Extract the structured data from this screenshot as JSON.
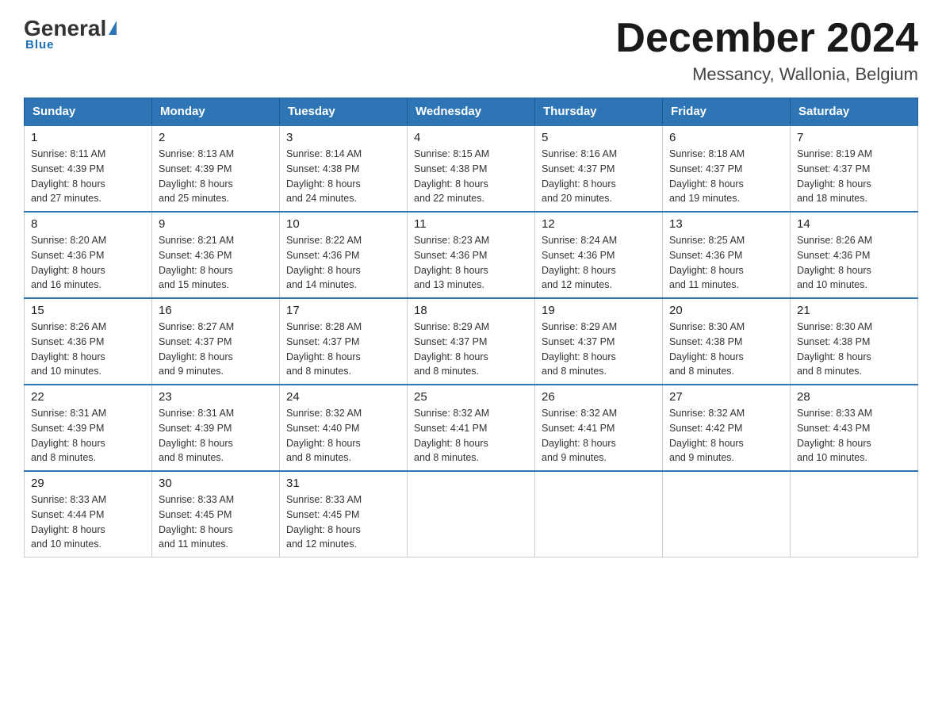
{
  "logo": {
    "general": "General",
    "blue": "Blue",
    "tagline": "Blue"
  },
  "title": {
    "month_year": "December 2024",
    "location": "Messancy, Wallonia, Belgium"
  },
  "header_days": [
    "Sunday",
    "Monday",
    "Tuesday",
    "Wednesday",
    "Thursday",
    "Friday",
    "Saturday"
  ],
  "weeks": [
    [
      {
        "day": "1",
        "sunrise": "8:11 AM",
        "sunset": "4:39 PM",
        "daylight": "8 hours and 27 minutes."
      },
      {
        "day": "2",
        "sunrise": "8:13 AM",
        "sunset": "4:39 PM",
        "daylight": "8 hours and 25 minutes."
      },
      {
        "day": "3",
        "sunrise": "8:14 AM",
        "sunset": "4:38 PM",
        "daylight": "8 hours and 24 minutes."
      },
      {
        "day": "4",
        "sunrise": "8:15 AM",
        "sunset": "4:38 PM",
        "daylight": "8 hours and 22 minutes."
      },
      {
        "day": "5",
        "sunrise": "8:16 AM",
        "sunset": "4:37 PM",
        "daylight": "8 hours and 20 minutes."
      },
      {
        "day": "6",
        "sunrise": "8:18 AM",
        "sunset": "4:37 PM",
        "daylight": "8 hours and 19 minutes."
      },
      {
        "day": "7",
        "sunrise": "8:19 AM",
        "sunset": "4:37 PM",
        "daylight": "8 hours and 18 minutes."
      }
    ],
    [
      {
        "day": "8",
        "sunrise": "8:20 AM",
        "sunset": "4:36 PM",
        "daylight": "8 hours and 16 minutes."
      },
      {
        "day": "9",
        "sunrise": "8:21 AM",
        "sunset": "4:36 PM",
        "daylight": "8 hours and 15 minutes."
      },
      {
        "day": "10",
        "sunrise": "8:22 AM",
        "sunset": "4:36 PM",
        "daylight": "8 hours and 14 minutes."
      },
      {
        "day": "11",
        "sunrise": "8:23 AM",
        "sunset": "4:36 PM",
        "daylight": "8 hours and 13 minutes."
      },
      {
        "day": "12",
        "sunrise": "8:24 AM",
        "sunset": "4:36 PM",
        "daylight": "8 hours and 12 minutes."
      },
      {
        "day": "13",
        "sunrise": "8:25 AM",
        "sunset": "4:36 PM",
        "daylight": "8 hours and 11 minutes."
      },
      {
        "day": "14",
        "sunrise": "8:26 AM",
        "sunset": "4:36 PM",
        "daylight": "8 hours and 10 minutes."
      }
    ],
    [
      {
        "day": "15",
        "sunrise": "8:26 AM",
        "sunset": "4:36 PM",
        "daylight": "8 hours and 10 minutes."
      },
      {
        "day": "16",
        "sunrise": "8:27 AM",
        "sunset": "4:37 PM",
        "daylight": "8 hours and 9 minutes."
      },
      {
        "day": "17",
        "sunrise": "8:28 AM",
        "sunset": "4:37 PM",
        "daylight": "8 hours and 8 minutes."
      },
      {
        "day": "18",
        "sunrise": "8:29 AM",
        "sunset": "4:37 PM",
        "daylight": "8 hours and 8 minutes."
      },
      {
        "day": "19",
        "sunrise": "8:29 AM",
        "sunset": "4:37 PM",
        "daylight": "8 hours and 8 minutes."
      },
      {
        "day": "20",
        "sunrise": "8:30 AM",
        "sunset": "4:38 PM",
        "daylight": "8 hours and 8 minutes."
      },
      {
        "day": "21",
        "sunrise": "8:30 AM",
        "sunset": "4:38 PM",
        "daylight": "8 hours and 8 minutes."
      }
    ],
    [
      {
        "day": "22",
        "sunrise": "8:31 AM",
        "sunset": "4:39 PM",
        "daylight": "8 hours and 8 minutes."
      },
      {
        "day": "23",
        "sunrise": "8:31 AM",
        "sunset": "4:39 PM",
        "daylight": "8 hours and 8 minutes."
      },
      {
        "day": "24",
        "sunrise": "8:32 AM",
        "sunset": "4:40 PM",
        "daylight": "8 hours and 8 minutes."
      },
      {
        "day": "25",
        "sunrise": "8:32 AM",
        "sunset": "4:41 PM",
        "daylight": "8 hours and 8 minutes."
      },
      {
        "day": "26",
        "sunrise": "8:32 AM",
        "sunset": "4:41 PM",
        "daylight": "8 hours and 9 minutes."
      },
      {
        "day": "27",
        "sunrise": "8:32 AM",
        "sunset": "4:42 PM",
        "daylight": "8 hours and 9 minutes."
      },
      {
        "day": "28",
        "sunrise": "8:33 AM",
        "sunset": "4:43 PM",
        "daylight": "8 hours and 10 minutes."
      }
    ],
    [
      {
        "day": "29",
        "sunrise": "8:33 AM",
        "sunset": "4:44 PM",
        "daylight": "8 hours and 10 minutes."
      },
      {
        "day": "30",
        "sunrise": "8:33 AM",
        "sunset": "4:45 PM",
        "daylight": "8 hours and 11 minutes."
      },
      {
        "day": "31",
        "sunrise": "8:33 AM",
        "sunset": "4:45 PM",
        "daylight": "8 hours and 12 minutes."
      },
      null,
      null,
      null,
      null
    ]
  ],
  "labels": {
    "sunrise": "Sunrise:",
    "sunset": "Sunset:",
    "daylight": "Daylight:"
  }
}
